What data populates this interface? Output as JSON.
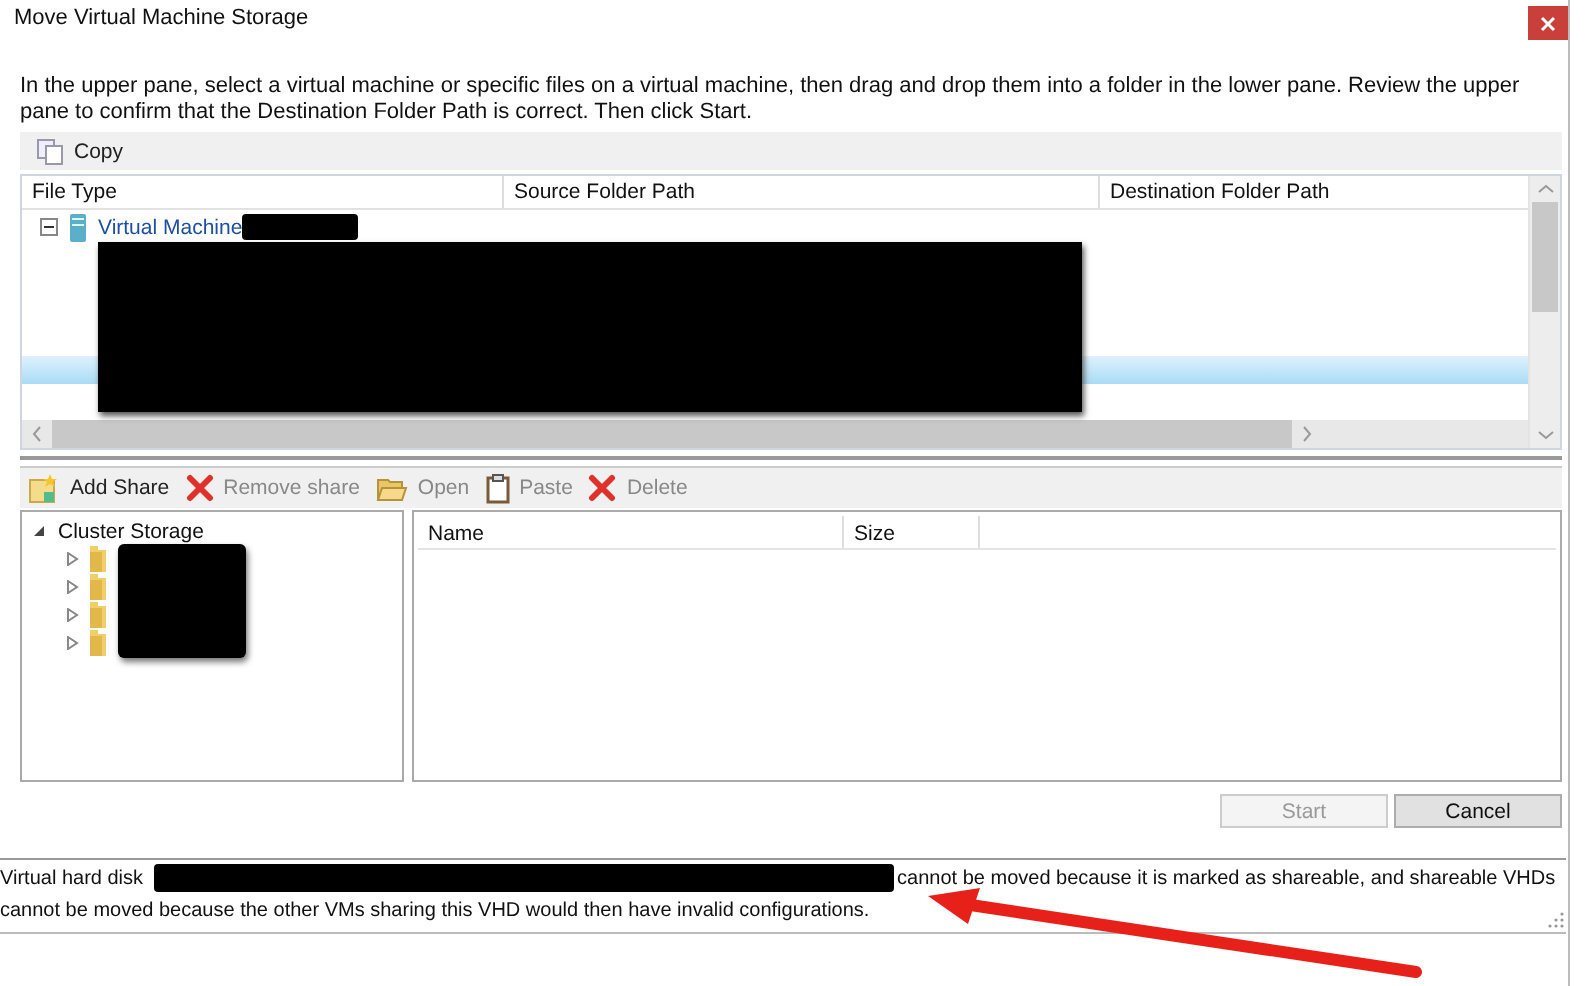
{
  "window": {
    "title": "Move Virtual Machine Storage"
  },
  "instructions": "In the upper pane, select a virtual machine or specific files on a virtual machine, then drag and drop them into a folder in the lower pane.  Review the upper pane to confirm that the Destination Folder Path is correct. Then click Start.",
  "upper_toolbar": [
    {
      "label": "Copy",
      "disabled": false
    }
  ],
  "upper_table": {
    "columns": [
      "File Type",
      "Source Folder Path",
      "Destination Folder Path"
    ],
    "rows": [
      {
        "label": "Virtual Machine",
        "expanded": true
      }
    ]
  },
  "lower_toolbar": [
    {
      "label": "Add Share",
      "kind": "add",
      "disabled": false
    },
    {
      "label": "Remove share",
      "kind": "remove",
      "disabled": true
    },
    {
      "label": "Open",
      "kind": "open",
      "disabled": true
    },
    {
      "label": "Paste",
      "kind": "paste",
      "disabled": true
    },
    {
      "label": "Delete",
      "kind": "remove",
      "disabled": true
    }
  ],
  "tree": [
    {
      "label": "Cluster Storage",
      "expanded": true,
      "children": [
        {
          "expanded": false
        },
        {
          "expanded": false
        },
        {
          "expanded": false
        },
        {
          "expanded": false
        }
      ]
    }
  ],
  "file_list": {
    "columns": [
      "Name",
      "Size"
    ]
  },
  "buttons": [
    {
      "label": "Start",
      "disabled": true
    },
    {
      "label": "Cancel",
      "disabled": false
    }
  ],
  "message": {
    "start": "Virtual hard disk",
    "rest": [
      "cannot be moved because it is marked as shareable, and shareable VHDs",
      "cannot be moved because the other VMs sharing this VHD would then have invalid configurations."
    ]
  }
}
